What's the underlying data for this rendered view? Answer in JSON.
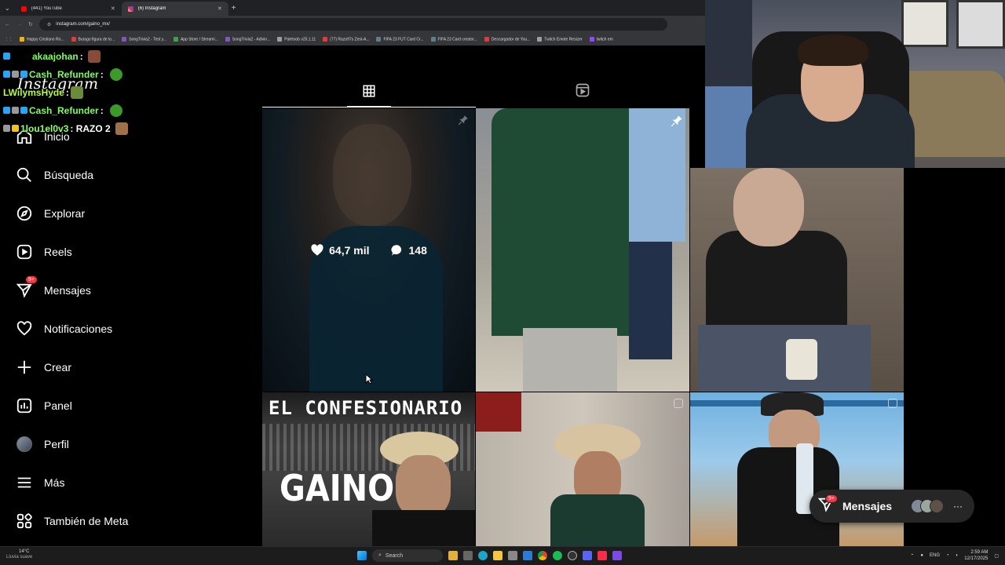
{
  "browser": {
    "tabs": [
      {
        "label": "(441) YouTube",
        "color": "#ff0000",
        "active": false
      },
      {
        "label": "(6) Instagram",
        "color": "#d62976",
        "active": true
      }
    ],
    "url": "instagram.com/gaino_mx/",
    "bookmarks": [
      {
        "label": "Happy Cristiano Ro...",
        "color": "#f4b400"
      },
      {
        "label": "Burago figura de to...",
        "color": "#e53935"
      },
      {
        "label": "SongTrivia2 - Test y...",
        "color": "#7e57c2"
      },
      {
        "label": "App Store / Streami...",
        "color": "#43a047"
      },
      {
        "label": "SongTrivia2 - Adivin...",
        "color": "#7e57c2"
      },
      {
        "label": "Paletoob v25.1.11",
        "color": "#9e9e9e"
      },
      {
        "label": "(77) Razo97s Zest-A...",
        "color": "#e53935"
      },
      {
        "label": "FIFA 23 FUT Card Cr...",
        "color": "#607d8b"
      },
      {
        "label": "FIFA 23 Card creator...",
        "color": "#607d8b"
      },
      {
        "label": "Descargador de You...",
        "color": "#e53935"
      },
      {
        "label": "Twitch Emote Resizer",
        "color": "#9e9e9e"
      },
      {
        "label": "twitch em",
        "color": "#9146ff"
      }
    ]
  },
  "instagram": {
    "logo": "Instagram",
    "nav": [
      {
        "key": "inicio",
        "label": "Inicio",
        "icon": "home-icon"
      },
      {
        "key": "busqueda",
        "label": "Búsqueda",
        "icon": "search-icon"
      },
      {
        "key": "explorar",
        "label": "Explorar",
        "icon": "compass-icon"
      },
      {
        "key": "reels",
        "label": "Reels",
        "icon": "reels-icon"
      },
      {
        "key": "mensajes",
        "label": "Mensajes",
        "icon": "messenger-icon",
        "badge": "9+"
      },
      {
        "key": "notificaciones",
        "label": "Notificaciones",
        "icon": "heart-icon"
      },
      {
        "key": "crear",
        "label": "Crear",
        "icon": "plus-icon"
      },
      {
        "key": "panel",
        "label": "Panel",
        "icon": "chart-icon"
      },
      {
        "key": "perfil",
        "label": "Perfil",
        "icon": "avatar-icon"
      },
      {
        "key": "mas",
        "label": "Más",
        "icon": "menu-icon"
      },
      {
        "key": "meta",
        "label": "También de Meta",
        "icon": "meta-icon"
      }
    ],
    "grid_tabs": [
      "grid-icon",
      "reels-tab-icon"
    ],
    "hovered_post": {
      "likes": "64,7 mil",
      "comments": "148"
    },
    "post_text": {
      "confesionario": "EL CONFESIONARIO",
      "gaino": "GAINO"
    },
    "floating_messages": {
      "label": "Mensajes",
      "badge": "9+"
    }
  },
  "chat": [
    {
      "user": "akaajohan",
      "text": ":"
    },
    {
      "user": "Cash_Refunder",
      "text": ":"
    },
    {
      "user": "LWilymsHyde",
      "text": ":"
    },
    {
      "user": "Cash_Refunder",
      "text": ":"
    },
    {
      "user": "1lou1el0v3",
      "text": ": RAZO 2"
    }
  ],
  "taskbar": {
    "weather_temp": "14°C",
    "weather_desc": "Lluvia suave",
    "search": "Search",
    "lang": "ENG",
    "time": "2:59 AM",
    "date": "12/17/2025"
  }
}
